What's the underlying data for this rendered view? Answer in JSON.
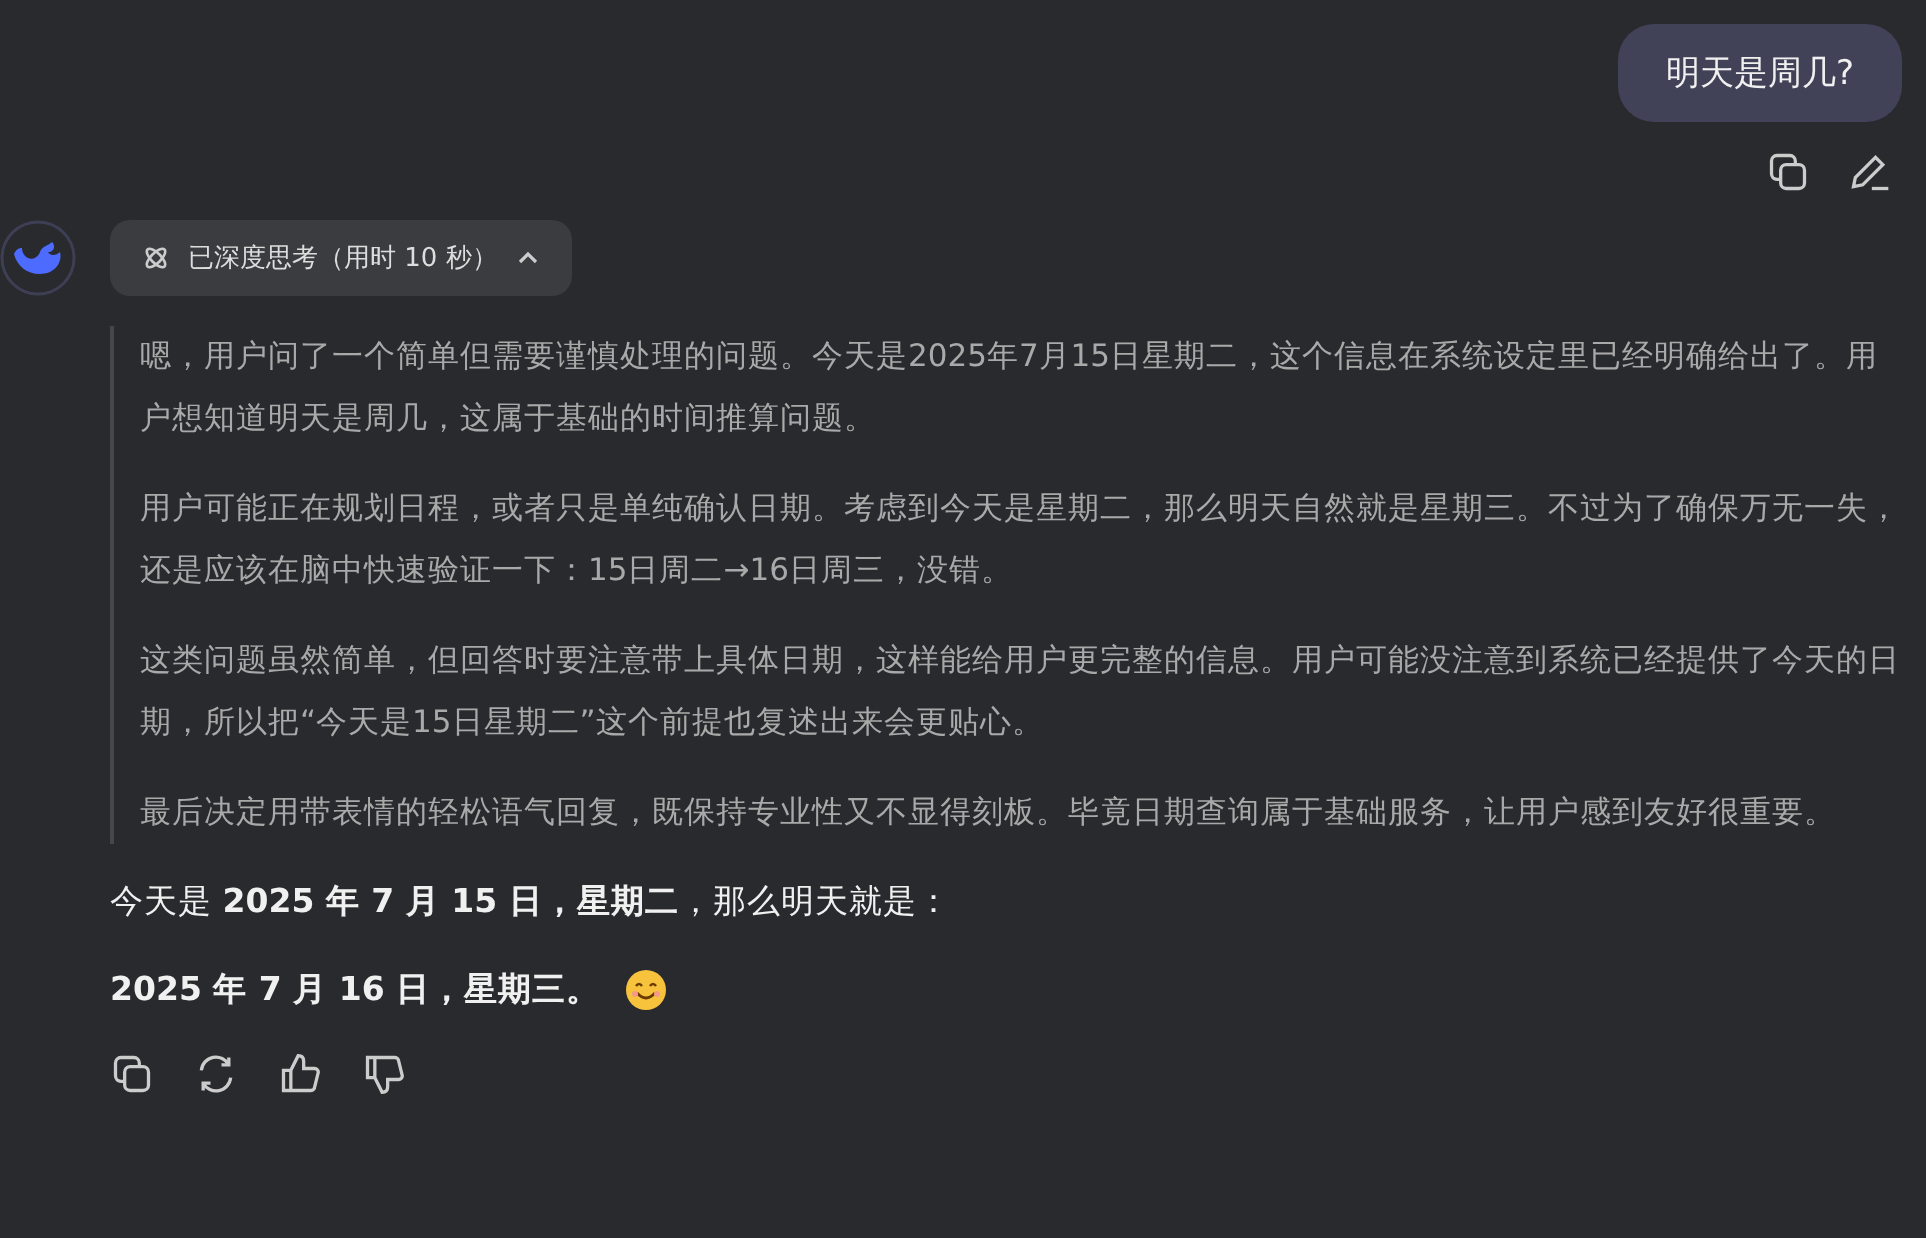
{
  "user_message": {
    "text": "明天是周几?"
  },
  "thinking": {
    "label": "已深度思考（用时 10 秒）",
    "expanded": true,
    "paragraphs": [
      "嗯，用户问了一个简单但需要谨慎处理的问题。今天是2025年7月15日星期二，这个信息在系统设定里已经明确给出了。用户想知道明天是周几，这属于基础的时间推算问题。",
      "用户可能正在规划日程，或者只是单纯确认日期。考虑到今天是星期二，那么明天自然就是星期三。不过为了确保万无一失，还是应该在脑中快速验证一下：15日周二→16日周三，没错。",
      "这类问题虽然简单，但回答时要注意带上具体日期，这样能给用户更完整的信息。用户可能没注意到系统已经提供了今天的日期，所以把“今天是15日星期二”这个前提也复述出来会更贴心。",
      "最后决定用带表情的轻松语气回复，既保持专业性又不显得刻板。毕竟日期查询属于基础服务，让用户感到友好很重要。"
    ]
  },
  "answer": [
    "今天是 **2025 年 7 月 15 日，星期二**，那么明天就是：",
    "**2025 年 7 月 16 日，星期三。**"
  ]
}
